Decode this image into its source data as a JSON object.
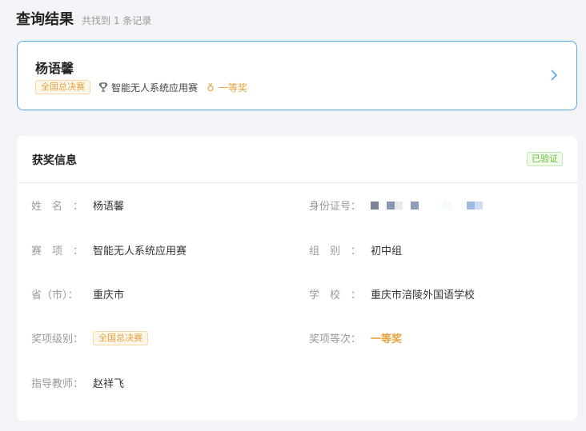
{
  "header": {
    "title": "查询结果",
    "subtitle": "共找到 1 条记录"
  },
  "result": {
    "name": "杨语馨",
    "level_tag": "全国总决赛",
    "competition": "智能无人系统应用赛",
    "prize": "一等奖",
    "icons": {
      "competition": "trophy-icon",
      "prize": "medal-icon",
      "action": "chevron-right-icon"
    }
  },
  "info": {
    "title": "获奖信息",
    "status": "已验证",
    "fields": {
      "name": {
        "label": "姓　名　：",
        "value": "杨语馨"
      },
      "id_number": {
        "label": "身份证号：",
        "value": ""
      },
      "event": {
        "label": "赛　项　：",
        "value": "智能无人系统应用赛"
      },
      "group": {
        "label": "组　别　：",
        "value": "初中组"
      },
      "province": {
        "label": "省（市）：",
        "value": "重庆市"
      },
      "school": {
        "label": "学　校　：",
        "value": "重庆市涪陵外国语学校"
      },
      "award_level": {
        "label": "奖项级别：",
        "value": "全国总决赛"
      },
      "award_rank": {
        "label": "奖项等次：",
        "value": "一等奖"
      },
      "teacher": {
        "label": "指导教师：",
        "value": "赵祥飞"
      }
    }
  },
  "colors": {
    "accent": "#53a8ea",
    "gold": "#e6a23c",
    "green": "#67c23a"
  }
}
